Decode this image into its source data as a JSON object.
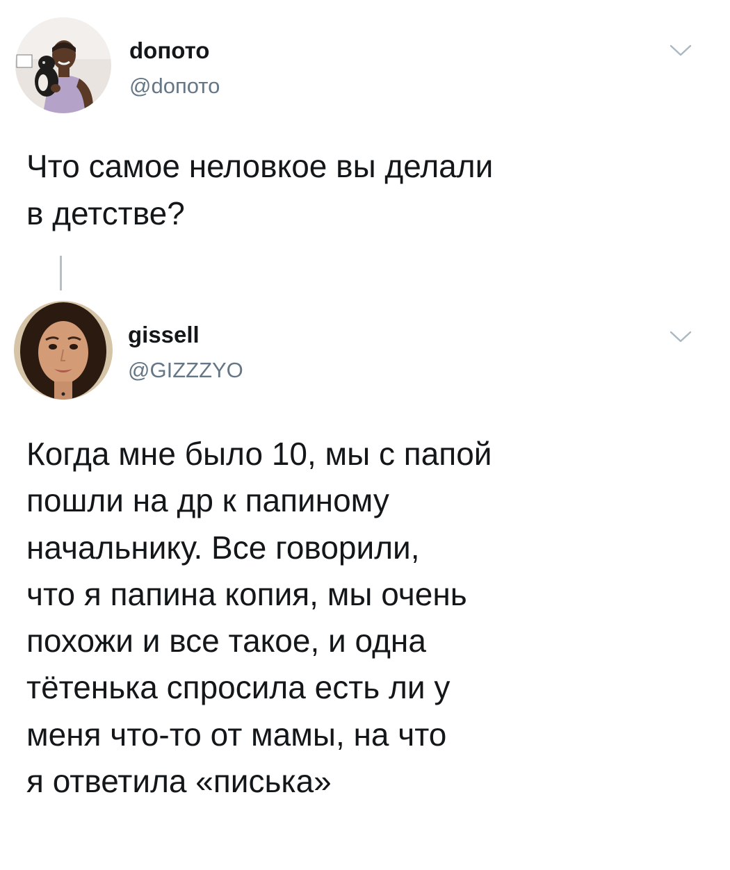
{
  "thread": {
    "tweets": [
      {
        "user": {
          "name": "dопото",
          "handle": "@dопото",
          "avatar_icon": "avatar-photo-man-with-dog"
        },
        "text": "Что самое неловкое вы делали\nв детстве?",
        "menu_icon": "chevron-down-icon"
      },
      {
        "user": {
          "name": "gissell",
          "handle": "@GIZZZYO",
          "avatar_icon": "avatar-photo-woman"
        },
        "text": "Когда мне было 10, мы с папой\nпошли на др к папиному\nначальнику. Все говорили,\nчто я папина копия, мы очень\nпохожи и все такое, и одна\nтётенька спросила есть ли у\nменя что-то от мамы, на что\nя ответила «писька»",
        "menu_icon": "chevron-down-icon"
      }
    ]
  },
  "colors": {
    "text_primary": "#14171a",
    "text_secondary": "#657786",
    "chevron": "#aab8c2",
    "thread_line": "#b9bec3"
  }
}
